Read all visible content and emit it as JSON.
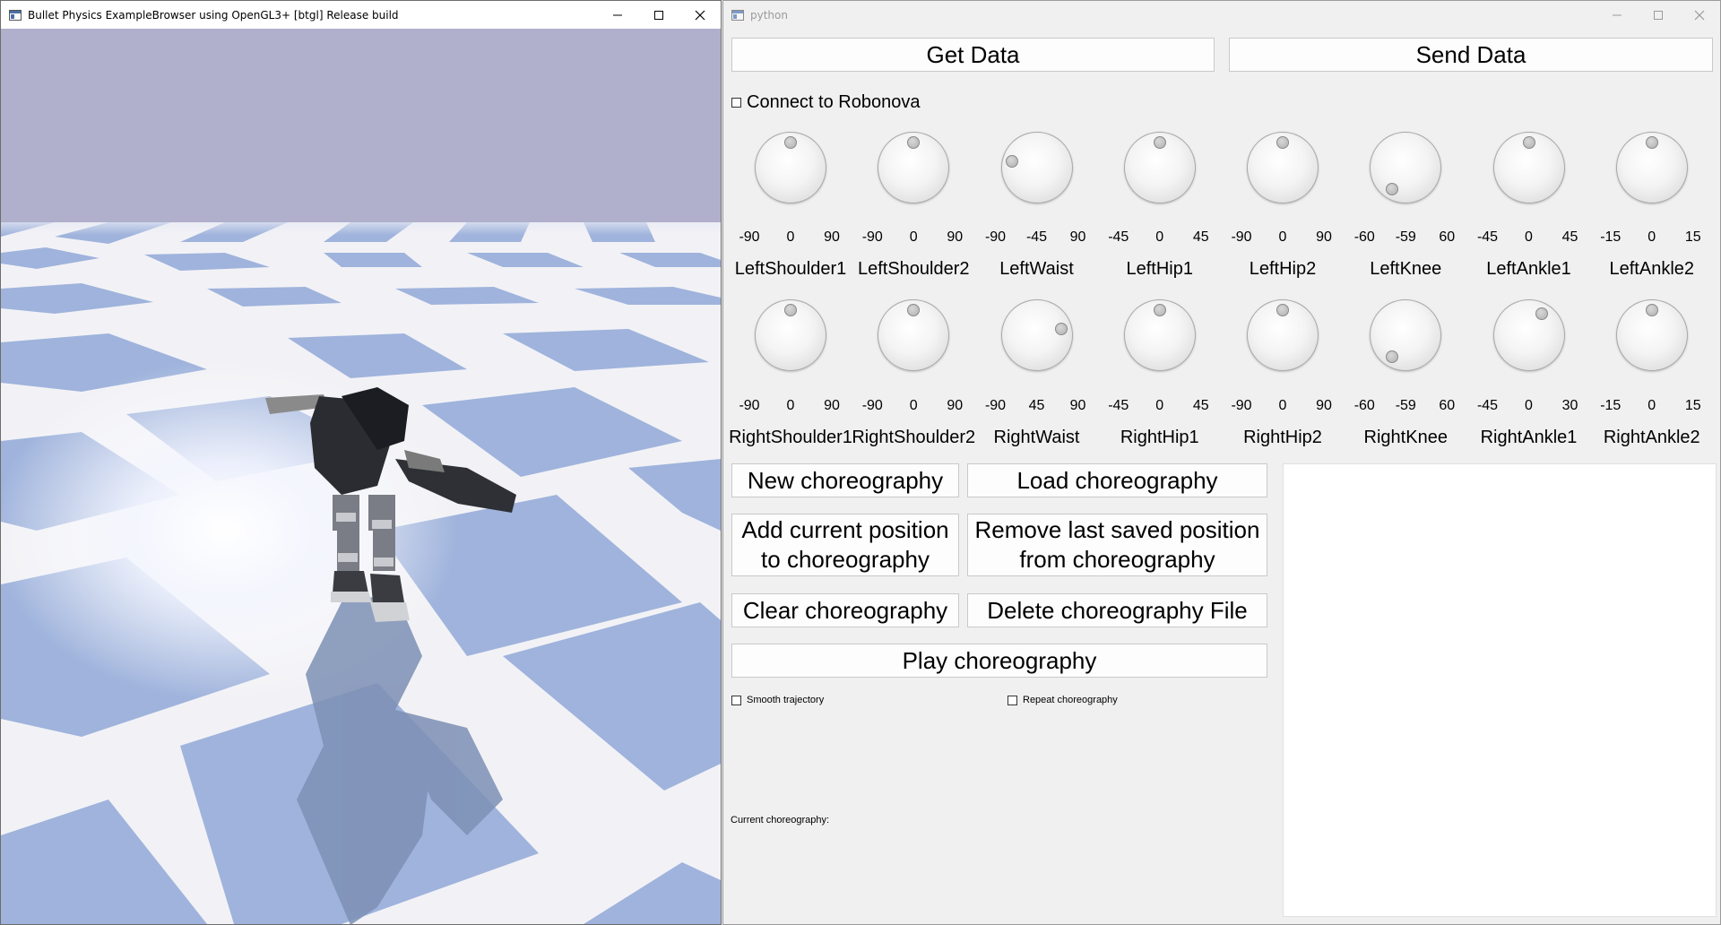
{
  "sim_window": {
    "title": "Bullet Physics ExampleBrowser using OpenGL3+ [btgl] Release build"
  },
  "control_window": {
    "title": "python",
    "get_data_label": "Get Data",
    "send_data_label": "Send Data",
    "connect_label": "Connect to Robonova",
    "connect_checked": false,
    "joints_row1": [
      {
        "name": "LeftShoulder1",
        "min": "-90",
        "value": "0",
        "max": "90",
        "value_num": 0,
        "range": [
          -90,
          90
        ]
      },
      {
        "name": "LeftShoulder2",
        "min": "-90",
        "value": "0",
        "max": "90",
        "value_num": 0,
        "range": [
          -90,
          90
        ]
      },
      {
        "name": "LeftWaist",
        "min": "-90",
        "value": "-45",
        "max": "90",
        "value_num": -45,
        "range": [
          -90,
          90
        ]
      },
      {
        "name": "LeftHip1",
        "min": "-45",
        "value": "0",
        "max": "45",
        "value_num": 0,
        "range": [
          -45,
          45
        ]
      },
      {
        "name": "LeftHip2",
        "min": "-90",
        "value": "0",
        "max": "90",
        "value_num": 0,
        "range": [
          -90,
          90
        ]
      },
      {
        "name": "LeftKnee",
        "min": "-60",
        "value": "-59",
        "max": "60",
        "value_num": -59,
        "range": [
          -60,
          60
        ]
      },
      {
        "name": "LeftAnkle1",
        "min": "-45",
        "value": "0",
        "max": "45",
        "value_num": 0,
        "range": [
          -45,
          45
        ]
      },
      {
        "name": "LeftAnkle2",
        "min": "-15",
        "value": "0",
        "max": "15",
        "value_num": 0,
        "range": [
          -15,
          15
        ]
      }
    ],
    "joints_row2": [
      {
        "name": "RightShoulder1",
        "min": "-90",
        "value": "0",
        "max": "90",
        "value_num": 0,
        "range": [
          -90,
          90
        ]
      },
      {
        "name": "RightShoulder2",
        "min": "-90",
        "value": "0",
        "max": "90",
        "value_num": 0,
        "range": [
          -90,
          90
        ]
      },
      {
        "name": "RightWaist",
        "min": "-90",
        "value": "45",
        "max": "90",
        "value_num": 45,
        "range": [
          -90,
          90
        ]
      },
      {
        "name": "RightHip1",
        "min": "-45",
        "value": "0",
        "max": "45",
        "value_num": 0,
        "range": [
          -45,
          45
        ]
      },
      {
        "name": "RightHip2",
        "min": "-90",
        "value": "0",
        "max": "90",
        "value_num": 0,
        "range": [
          -90,
          90
        ]
      },
      {
        "name": "RightKnee",
        "min": "-60",
        "value": "-59",
        "max": "60",
        "value_num": -59,
        "range": [
          -60,
          60
        ]
      },
      {
        "name": "RightAnkle1",
        "min": "-45",
        "value": "0",
        "max": "30",
        "value_num": 0,
        "range": [
          -45,
          30
        ]
      },
      {
        "name": "RightAnkle2",
        "min": "-15",
        "value": "0",
        "max": "15",
        "value_num": 0,
        "range": [
          -15,
          15
        ]
      }
    ],
    "new_choreo_label": "New choreography",
    "load_choreo_label": "Load choreography",
    "add_position_label": "Add current position to choreography",
    "remove_position_label": "Remove last saved position from choreography",
    "clear_choreo_label": "Clear choreography",
    "delete_file_label": "Delete choreography File",
    "play_label": "Play choreography",
    "smooth_label": "Smooth trajectory",
    "smooth_checked": false,
    "repeat_label": "Repeat choreography",
    "repeat_checked": false,
    "current_choreo_label": "Current choreography:",
    "choreo_list": []
  },
  "colors": {
    "sky": "#b0b0cc",
    "floor_light": "#f2f2f6",
    "floor_dark": "#9fb3dc",
    "window_bg": "#f0f0f0"
  }
}
